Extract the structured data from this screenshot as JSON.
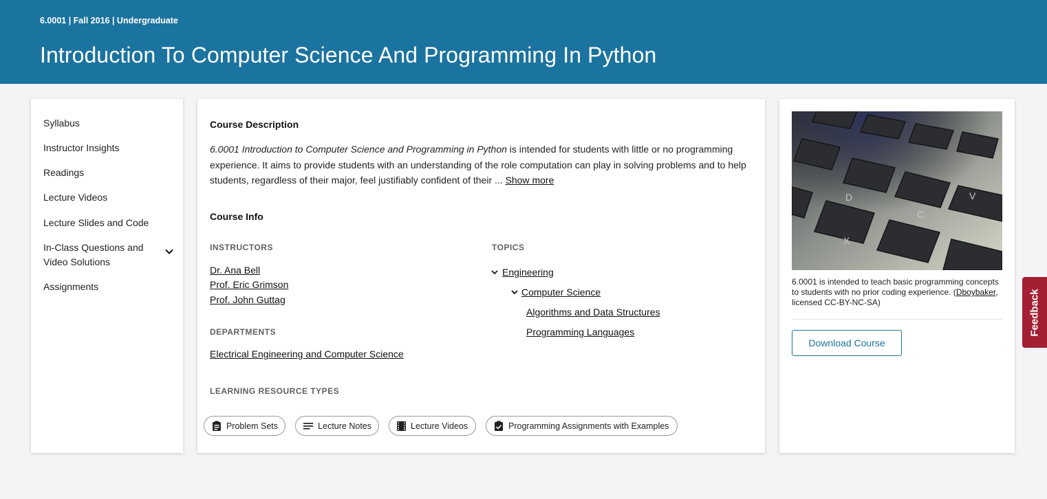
{
  "header": {
    "meta": "6.0001 | Fall 2016 | Undergraduate",
    "title": "Introduction To Computer Science And Programming In Python"
  },
  "sidebar": {
    "items": [
      {
        "label": "Syllabus"
      },
      {
        "label": "Instructor Insights"
      },
      {
        "label": "Readings"
      },
      {
        "label": "Lecture Videos"
      },
      {
        "label": "Lecture Slides and Code"
      },
      {
        "label": "In-Class Questions and Video Solutions",
        "line1": "In-Class Questions and",
        "line2": "Video Solutions",
        "expandable": true
      },
      {
        "label": "Assignments"
      }
    ]
  },
  "main": {
    "description_heading": "Course Description",
    "description_title": "6.0001 Introduction to Computer Science and Programming in Python",
    "description_text": " is intended for students with little or no programming experience. It aims to provide students with an understanding of the role computation can play in solving problems and to help students, regardless of their major, feel justifiably confident of their ... ",
    "show_more": "Show more",
    "info_heading": "Course Info",
    "instructors_label": "INSTRUCTORS",
    "instructors": [
      "Dr. Ana Bell",
      "Prof. Eric Grimson",
      "Prof. John Guttag"
    ],
    "departments_label": "DEPARTMENTS",
    "departments": [
      "Electrical Engineering and Computer Science"
    ],
    "topics_label": "TOPICS",
    "topics": {
      "level1": "Engineering",
      "level2": "Computer Science",
      "level3": [
        "Algorithms and Data Structures",
        "Programming Languages"
      ]
    },
    "resource_types_label": "LEARNING RESOURCE TYPES",
    "resource_types": [
      {
        "label": "Problem Sets",
        "icon": "clipboard-icon"
      },
      {
        "label": "Lecture Notes",
        "icon": "notes-lines-icon"
      },
      {
        "label": "Lecture Videos",
        "icon": "film-icon"
      },
      {
        "label": "Programming Assignments with Examples",
        "icon": "clipboard-check-icon"
      }
    ]
  },
  "aside": {
    "image_caption_text": "6.0001 is intended to teach basic programming concepts to students with no prior coding experience. (",
    "image_credit": "Dboybaker",
    "image_caption_suffix": ", licensed CC-BY-NC-SA)",
    "keyboard_keys": [
      "D",
      "C",
      "V",
      "X"
    ],
    "download_label": "Download Course"
  },
  "feedback_label": "Feedback",
  "colors": {
    "banner": "#1b739f",
    "background": "#f4f3f6",
    "feedback": "#a31f34",
    "accent": "#1b739f"
  }
}
